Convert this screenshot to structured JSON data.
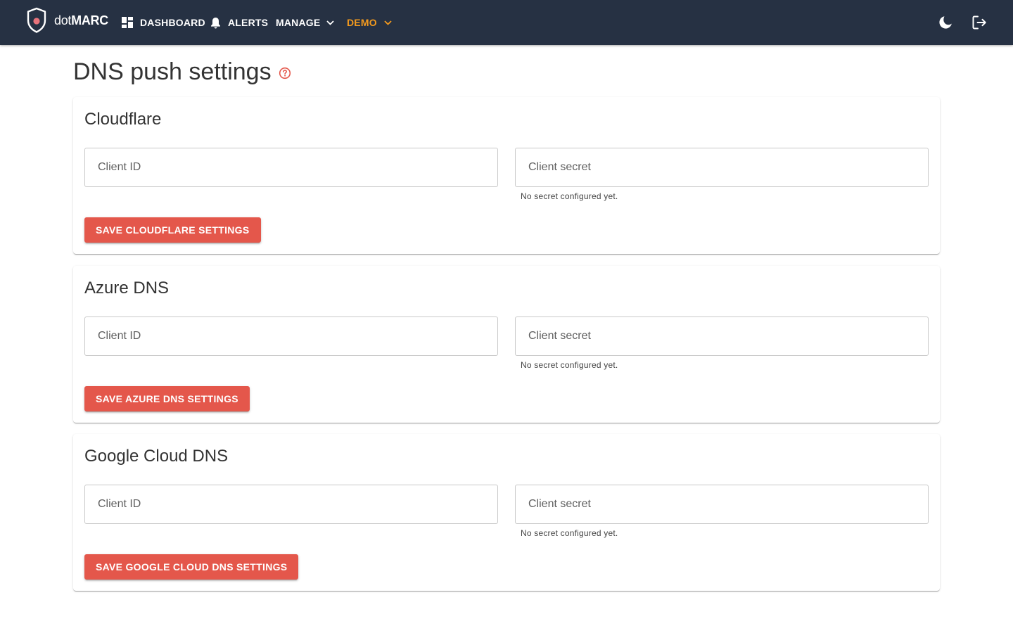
{
  "app": {
    "brand_prefix": "dot",
    "brand_suffix": "MARC"
  },
  "nav": {
    "dashboard": "DASHBOARD",
    "alerts": "ALERTS",
    "manage": "MANAGE",
    "demo": "DEMO"
  },
  "header_icons": {
    "theme_toggle": "moon-icon",
    "logout": "logout-icon"
  },
  "page": {
    "title": "DNS push settings",
    "help_icon": "help-circle-icon"
  },
  "providers": [
    {
      "title": "Cloudflare",
      "client_id_placeholder": "Client ID",
      "client_secret_placeholder": "Client secret",
      "secret_hint": "No secret configured yet.",
      "save_label": "SAVE CLOUDFLARE SETTINGS"
    },
    {
      "title": "Azure DNS",
      "client_id_placeholder": "Client ID",
      "client_secret_placeholder": "Client secret",
      "secret_hint": "No secret configured yet.",
      "save_label": "SAVE AZURE DNS SETTINGS"
    },
    {
      "title": "Google Cloud DNS",
      "client_id_placeholder": "Client ID",
      "client_secret_placeholder": "Client secret",
      "secret_hint": "No secret configured yet.",
      "save_label": "SAVE GOOGLE CLOUD DNS SETTINGS"
    }
  ],
  "colors": {
    "topbar": "#263143",
    "accent": "#e4574b",
    "demo": "#f39a1e"
  }
}
